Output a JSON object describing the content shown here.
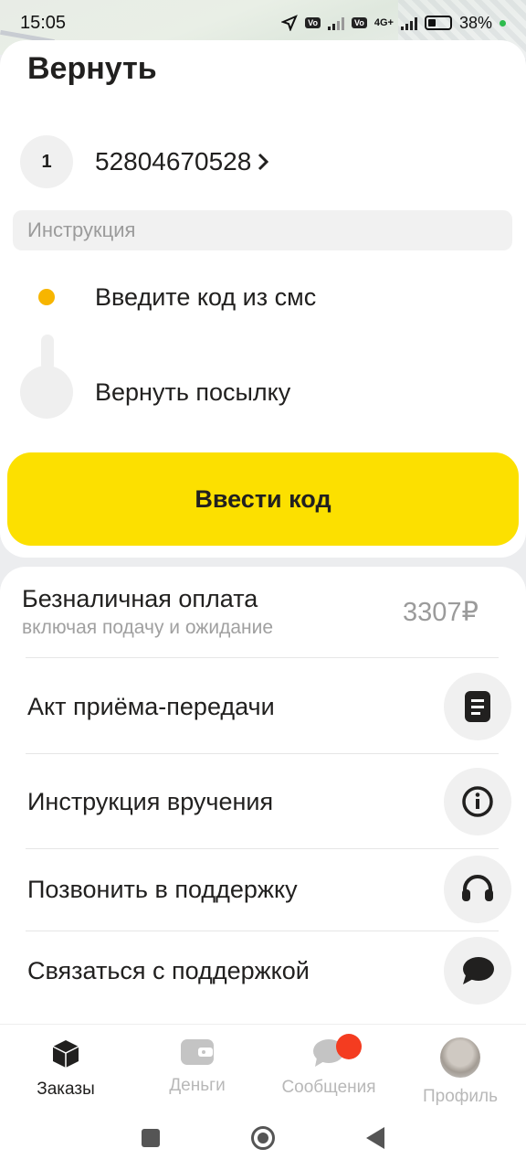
{
  "status_bar": {
    "time": "15:05",
    "battery": "38%",
    "network": "4G+",
    "sim_label": "Vo LTE"
  },
  "header": {
    "title": "Вернуть"
  },
  "order": {
    "index": "1",
    "number": "52804670528",
    "chevron": "›"
  },
  "instructions": {
    "section_label": "Инструкция",
    "steps": [
      {
        "label": "Введите код из смс",
        "state": "current"
      },
      {
        "label": "Вернуть посылку",
        "state": "pending"
      }
    ]
  },
  "cta": {
    "label": "Ввести код"
  },
  "payment": {
    "title": "Безналичная оплата",
    "subtitle": "включая подачу и ожидание",
    "amount": "3307₽"
  },
  "menu": [
    {
      "label": "Акт приёма-передачи",
      "icon": "document-icon"
    },
    {
      "label": "Инструкция вручения",
      "icon": "info-icon"
    },
    {
      "label": "Позвонить в поддержку",
      "icon": "headset-icon"
    },
    {
      "label": "Связаться с поддержкой",
      "icon": "chat-bubble-icon"
    }
  ],
  "bottom_nav": [
    {
      "label": "Заказы",
      "icon": "box-icon",
      "active": true
    },
    {
      "label": "Деньги",
      "icon": "wallet-icon",
      "active": false
    },
    {
      "label": "Сообщения",
      "icon": "messages-icon",
      "active": false,
      "badge": true
    },
    {
      "label": "Профиль",
      "icon": "avatar-icon",
      "active": false
    }
  ],
  "colors": {
    "accent": "#fce000",
    "step_dot": "#f7b500",
    "badge": "#f43c20"
  }
}
